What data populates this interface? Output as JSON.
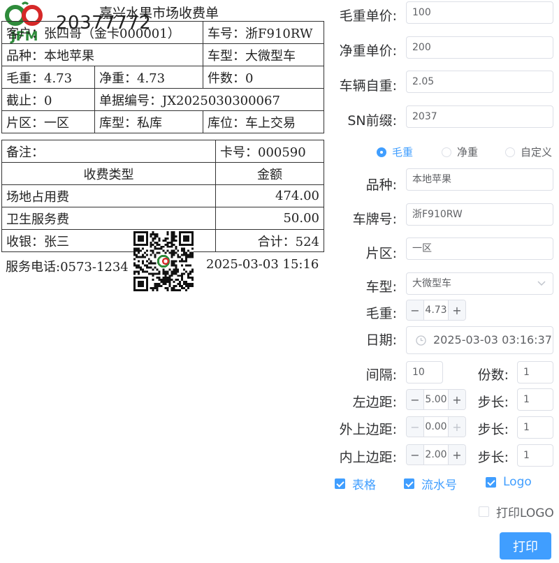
{
  "receipt": {
    "title": "嘉兴水果市场收费单",
    "serial": "20377772",
    "logo_text": "JFM",
    "buyer": "客户：张四哥（金卡000001）",
    "plate": "车号：浙F910RW",
    "variety": "品种：本地苹果",
    "vehicle_type": "车型：大微型车",
    "gross": "毛重：4.73",
    "net": "净重：4.73",
    "pieces": "件数：0",
    "cutoff": "截止：0",
    "bill_no": "单据编号：JX2025030300067",
    "area": "片区：一区",
    "warehouse_type": "库型：私库",
    "location": "库位：车上交易",
    "remark": "备注：",
    "card_no": "卡号：000590",
    "fee_type_header": "收费类型",
    "amount_header": "金额",
    "fees": [
      {
        "name": "场地占用费",
        "amount": "474.00"
      },
      {
        "name": "卫生服务费",
        "amount": "50.00"
      }
    ],
    "cashier": "收银：张三",
    "total": "合计：524",
    "phone": "服务电话:0573-1234",
    "datetime": "2025-03-03 15:16"
  },
  "form": {
    "gross_price_label": "毛重单价:",
    "gross_price_value": "100",
    "net_price_label": "净重单价:",
    "net_price_value": "200",
    "tare_label": "车辆自重:",
    "tare_value": "2.05",
    "sn_label": "SN前缀:",
    "sn_value": "2037",
    "radio_options": [
      "毛重",
      "净重",
      "自定义"
    ],
    "radio_selected": "毛重",
    "variety_label": "品种:",
    "variety_value": "本地苹果",
    "plate_label": "车牌号:",
    "plate_value": "浙F910RW",
    "area_label": "片区:",
    "area_value": "一区",
    "vehicle_label": "车型:",
    "vehicle_value": "大微型车",
    "gross_label": "毛重:",
    "gross_value": "4.73",
    "date_label": "日期:",
    "date_value": "2025-03-03 03:16:37",
    "interval_label": "间隔:",
    "interval_value": "10",
    "copies_label": "份数:",
    "copies_value": "1",
    "left_margin_label": "左边距:",
    "left_margin_value": "5.00",
    "step_label": "步长:",
    "step1_value": "1",
    "outer_top_label": "外上边距:",
    "outer_top_value": "0.00",
    "step2_value": "1",
    "inner_top_label": "内上边距:",
    "inner_top_value": "2.00",
    "step3_value": "1",
    "chk_table": "表格",
    "chk_serial": "流水号",
    "chk_logo": "Logo",
    "chk_print_logo": "打印LOGO",
    "print_button": "打印"
  },
  "colors": {
    "accent": "#409eff",
    "border": "#dcdfe6",
    "text": "#303133"
  }
}
